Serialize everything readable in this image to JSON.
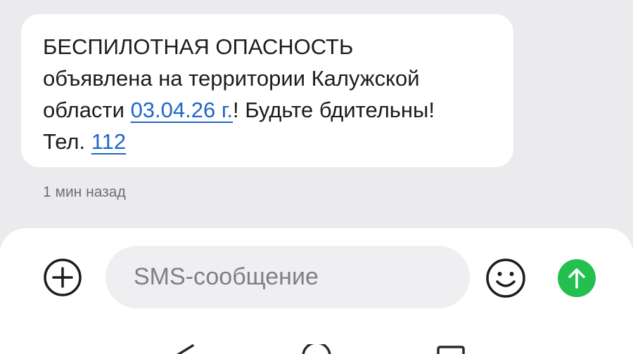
{
  "message": {
    "line1": "БЕСПИЛОТНАЯ ОПАСНОСТЬ",
    "line2": "объявлена на территории Калужской",
    "line3_prefix": "области ",
    "date_link": "03.04.26 г.",
    "line3_suffix": "! Будьте бдительны!",
    "line4_prefix": "Тел. ",
    "phone_link": "112",
    "timestamp": "1 мин назад"
  },
  "composer": {
    "placeholder": "SMS-сообщение",
    "add_icon": "plus-circle-icon",
    "emoji_icon": "smiley-icon",
    "send_icon": "send-arrow-up-icon"
  },
  "navbar": {
    "icons": [
      "back-triangle-icon",
      "home-circle-icon",
      "recents-square-icon"
    ]
  },
  "colors": {
    "background": "#ebebed",
    "bubble": "#ffffff",
    "link": "#1f66c7",
    "send": "#23c04f",
    "timestamp": "#6f6f73"
  }
}
